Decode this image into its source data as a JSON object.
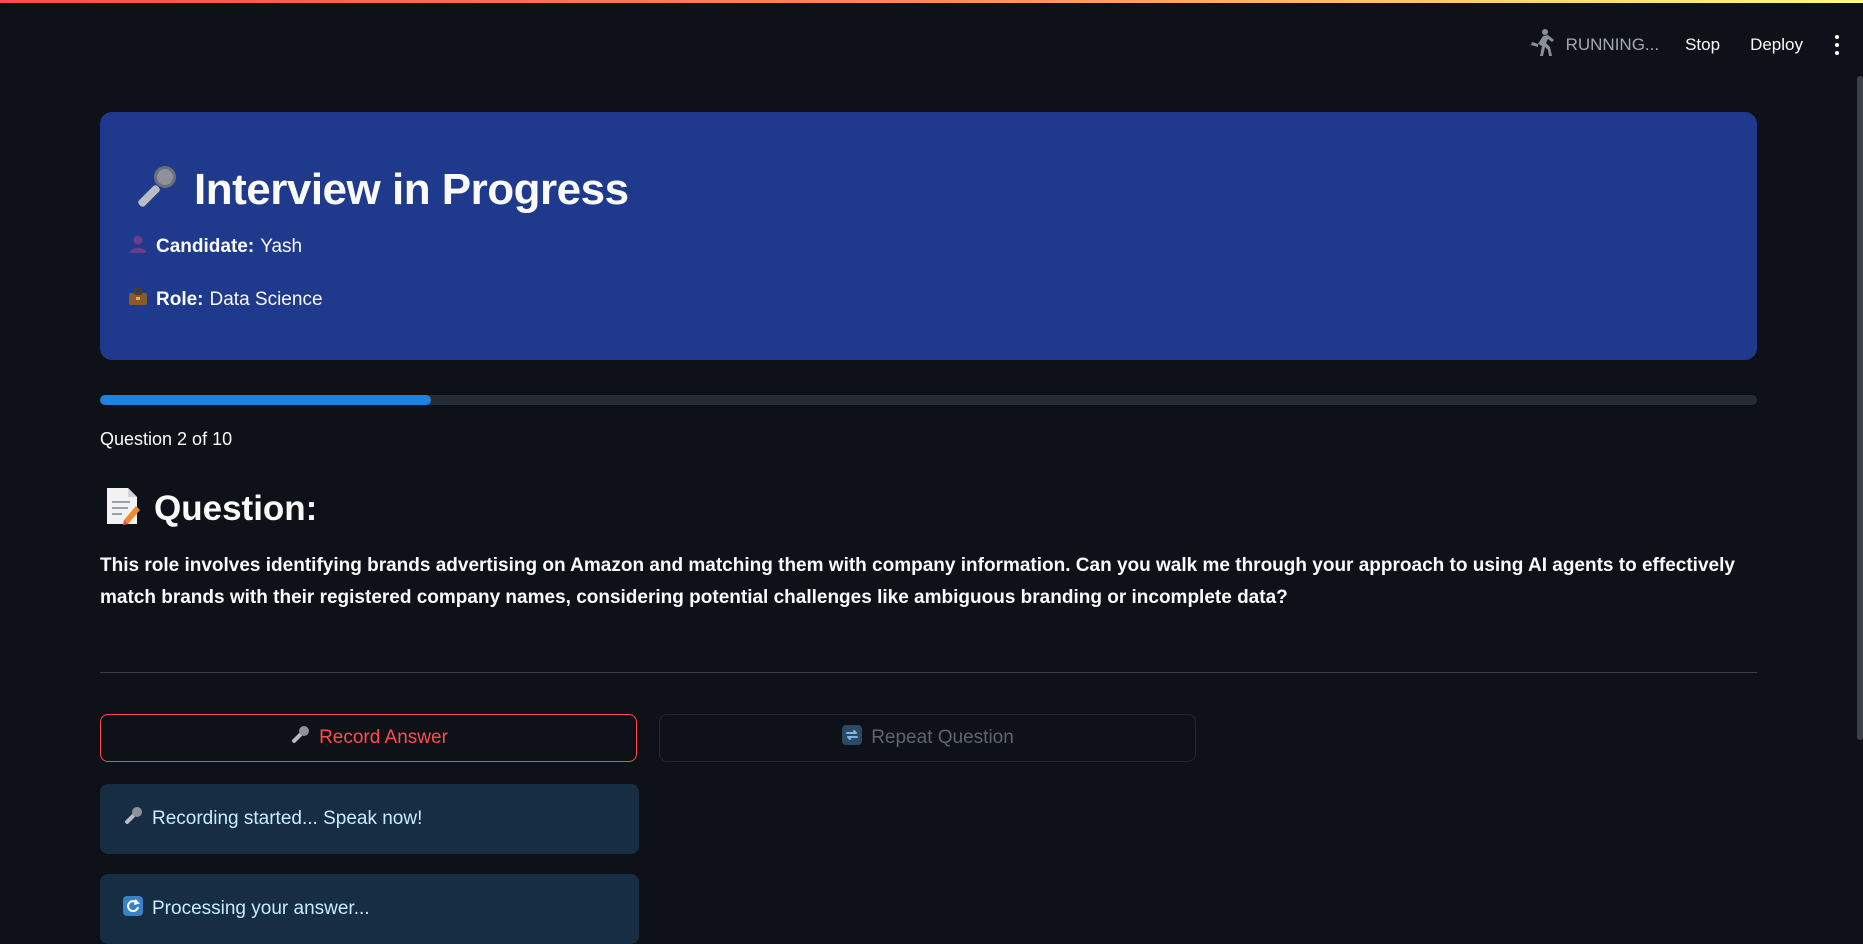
{
  "toolbar": {
    "status": "RUNNING...",
    "stop_label": "Stop",
    "deploy_label": "Deploy"
  },
  "header": {
    "title": "Interview in Progress",
    "candidate_label": "Candidate:",
    "candidate_value": "Yash",
    "role_label": "Role:",
    "role_value": "Data Science"
  },
  "progress": {
    "fraction": 0.2,
    "label": "Question 2 of 10"
  },
  "question": {
    "heading": "Question:",
    "text": "This role involves identifying brands advertising on Amazon and matching them with company information. Can you walk me through your approach to using AI agents to effectively match brands with their registered company names, considering potential challenges like ambiguous branding or incomplete data?"
  },
  "actions": {
    "record_label": "Record Answer",
    "repeat_label": "Repeat Question"
  },
  "alerts": [
    {
      "text": "Recording started... Speak now!"
    },
    {
      "text": "Processing your answer..."
    }
  ],
  "colors": {
    "background": "#0e1117",
    "header_card": "#1f3a8c",
    "progress_fill": "#1c83e1",
    "record_accent": "#ff4b4b",
    "alert_bg": "#172d43"
  },
  "icons": [
    "running-man-icon",
    "kebab-menu-icon",
    "microphone-icon",
    "bust-icon",
    "briefcase-icon",
    "memo-icon",
    "repeat-icon",
    "refresh-icon"
  ]
}
